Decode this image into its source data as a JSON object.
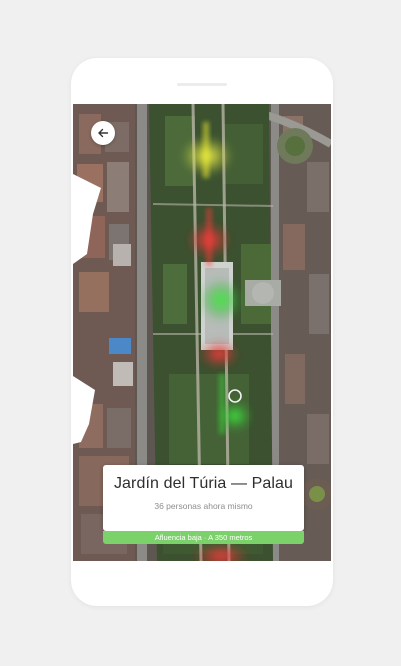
{
  "place": {
    "title": "Jardín del Túria — Palau",
    "subtitle": "36 personas ahora mismo",
    "status": "Afluencia baja · A 350 metros"
  },
  "colors": {
    "status_green": "#7bd16a",
    "heat_low": "#3ee03e",
    "heat_medium": "#f0f030",
    "heat_high": "#ff3a3a"
  },
  "icons": {
    "back": "arrow-left-icon",
    "location": "location-ring-icon"
  }
}
